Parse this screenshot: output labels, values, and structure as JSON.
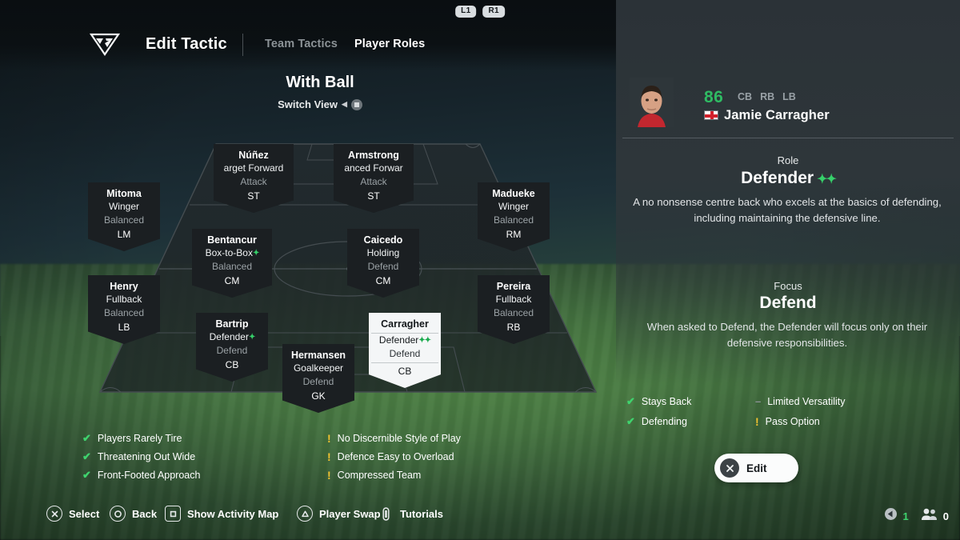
{
  "header": {
    "bumpers": [
      "L1",
      "R1"
    ],
    "logo_icon": "ea-fc-logo-icon",
    "title": "Edit Tactic",
    "tabs": [
      {
        "label": "Team Tactics",
        "active": false
      },
      {
        "label": "Player Roles",
        "active": true
      }
    ]
  },
  "pitch_header": {
    "title": "With Ball",
    "switch_view_label": "Switch View"
  },
  "formation": {
    "players": [
      {
        "name": "Mitoma",
        "role": "Winger",
        "focus": "Balanced",
        "position": "LM",
        "plus": 0,
        "selected": false
      },
      {
        "name": "Núñez",
        "role": "arget Forward",
        "focus": "Attack",
        "position": "ST",
        "plus": 0,
        "selected": false
      },
      {
        "name": "Armstrong",
        "role": "anced Forwar",
        "focus": "Attack",
        "position": "ST",
        "plus": 0,
        "selected": false
      },
      {
        "name": "Madueke",
        "role": "Winger",
        "focus": "Balanced",
        "position": "RM",
        "plus": 0,
        "selected": false
      },
      {
        "name": "Bentancur",
        "role": "Box-to-Box",
        "focus": "Balanced",
        "position": "CM",
        "plus": 1,
        "selected": false
      },
      {
        "name": "Caicedo",
        "role": "Holding",
        "focus": "Defend",
        "position": "CM",
        "plus": 0,
        "selected": false
      },
      {
        "name": "Henry",
        "role": "Fullback",
        "focus": "Balanced",
        "position": "LB",
        "plus": 0,
        "selected": false
      },
      {
        "name": "Pereira",
        "role": "Fullback",
        "focus": "Balanced",
        "position": "RB",
        "plus": 0,
        "selected": false
      },
      {
        "name": "Bartrip",
        "role": "Defender",
        "focus": "Defend",
        "position": "CB",
        "plus": 1,
        "selected": false
      },
      {
        "name": "Hermansen",
        "role": "Goalkeeper",
        "focus": "Defend",
        "position": "GK",
        "plus": 0,
        "selected": false
      },
      {
        "name": "Carragher",
        "role": "Defender",
        "focus": "Defend",
        "position": "CB",
        "plus": 2,
        "selected": true
      }
    ]
  },
  "tactic_summary": {
    "positives": [
      "Players Rarely Tire",
      "Threatening Out Wide",
      "Front-Footed Approach"
    ],
    "warnings": [
      "No Discernible Style of Play",
      "Defence Easy to Overload",
      "Compressed Team"
    ]
  },
  "player_panel": {
    "rating": "86",
    "positions": [
      "CB",
      "RB",
      "LB"
    ],
    "nation_icon": "england-flag-icon",
    "name": "Jamie Carragher",
    "role_label": "Role",
    "role_value": "Defender",
    "role_plus": "++",
    "role_desc": "A no nonsense centre back who excels at the basics of defending, including maintaining the defensive line.",
    "focus_label": "Focus",
    "focus_value": "Defend",
    "focus_desc": "When asked to Defend, the Defender will focus only on their defensive responsibilities.",
    "traits_left": [
      {
        "label": "Stays Back",
        "type": "ok"
      },
      {
        "label": "Defending",
        "type": "ok"
      }
    ],
    "traits_right": [
      {
        "label": "Limited Versatility",
        "type": "neutral"
      },
      {
        "label": "Pass Option",
        "type": "warn"
      }
    ],
    "edit_label": "Edit"
  },
  "bottom_bar": {
    "hints": [
      {
        "label": "Select",
        "button": "cross"
      },
      {
        "label": "Back",
        "button": "circle"
      },
      {
        "label": "Show Activity Map",
        "button": "square"
      },
      {
        "label": "Player Swap",
        "button": "triangle"
      },
      {
        "label": "Tutorials",
        "button": "options"
      }
    ],
    "counters": [
      {
        "icon": "back-arrow-icon",
        "value": "1",
        "color": "#3fd46e"
      },
      {
        "icon": "players-icon",
        "value": "0",
        "color": "#ffffff"
      }
    ]
  },
  "colors": {
    "accent_green": "#3fd46e",
    "rating_green": "#2fbb63",
    "warn_yellow": "#f2c230",
    "panel_bg": "#2e363a",
    "card_bg": "#1b1f22"
  }
}
